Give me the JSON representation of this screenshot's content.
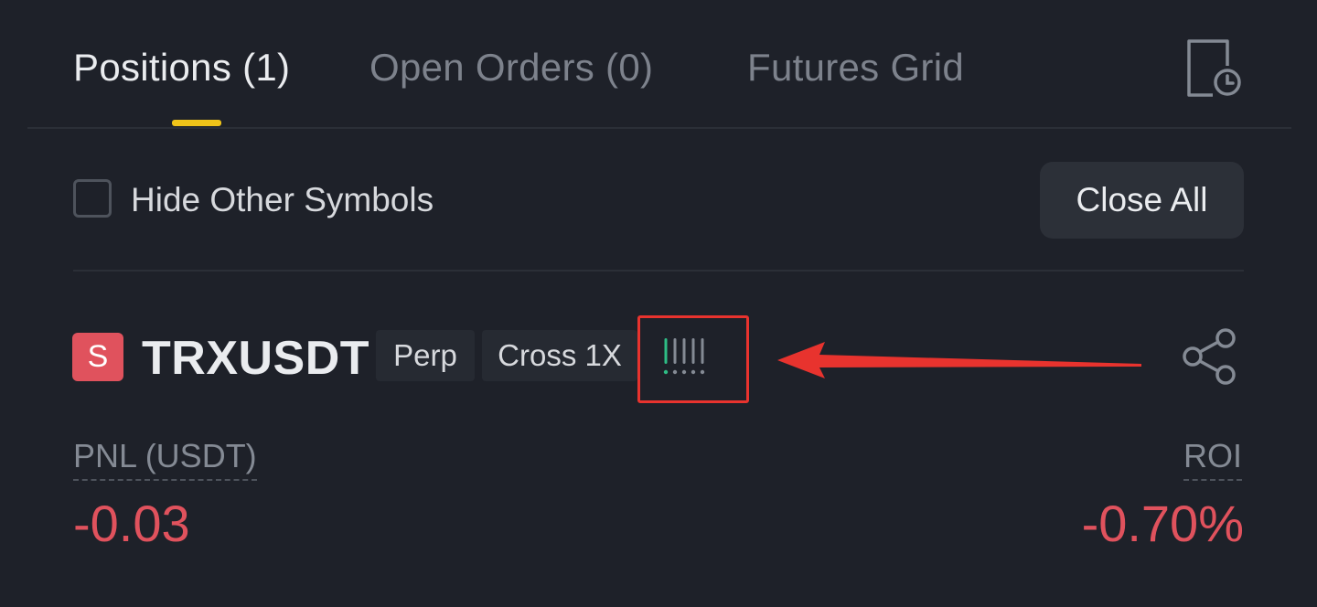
{
  "tabs": [
    {
      "label": "Positions (1)",
      "active": true
    },
    {
      "label": "Open Orders (0)",
      "active": false
    },
    {
      "label": "Futures Grid",
      "active": false
    }
  ],
  "filter": {
    "hide_other_symbols_label": "Hide Other Symbols",
    "hide_other_symbols_checked": false,
    "close_all_label": "Close All"
  },
  "position": {
    "side_badge": "S",
    "symbol": "TRXUSDT",
    "contract_type": "Perp",
    "margin_leverage": "Cross 1X",
    "adl_level": 1,
    "adl_max": 5,
    "pnl_label": "PNL (USDT)",
    "pnl_value": "-0.03",
    "roi_label": "ROI",
    "roi_value": "-0.70%"
  },
  "icons": {
    "history": "history-icon",
    "share": "share-icon",
    "adl": "adl-indicator-icon"
  },
  "colors": {
    "background": "#1e2129",
    "accent": "#f0c419",
    "loss": "#e0525d",
    "adl_active": "#2ebd85",
    "annotation": "#e8332e"
  }
}
